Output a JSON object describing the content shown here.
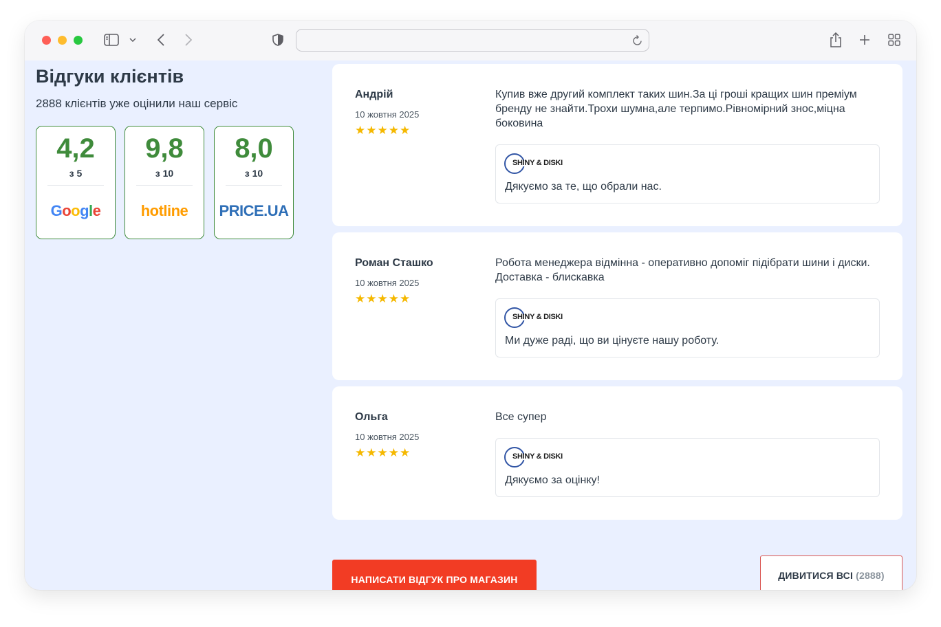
{
  "browser": {
    "address_value": ""
  },
  "sidebar": {
    "title": "Відгуки клієнтів",
    "subtitle": "2888 клієнтів уже оцінили наш сервіс",
    "ratings": [
      {
        "score": "4,2",
        "outof": "з 5",
        "brand": "Google"
      },
      {
        "score": "9,8",
        "outof": "з 10",
        "brand": "hotline"
      },
      {
        "score": "8,0",
        "outof": "з 10",
        "brand": "PRICE.UA"
      }
    ]
  },
  "reviews": [
    {
      "author": "Андрій",
      "date": "10 жовтня 2025",
      "stars": "★★★★★",
      "rating": 5,
      "text": "Купив вже другий комплект таких шин.За ці гроші кращих шин преміум бренду не знайти.Трохи шумна,але терпимо.Рівномірний знос,міцна боковина",
      "reply_brand": "SHINY & DISKI",
      "reply": "Дякуємо за те, що обрали нас."
    },
    {
      "author": "Роман Сташко",
      "date": "10 жовтня 2025",
      "stars": "★★★★★",
      "rating": 5,
      "text": "Робота менеджера відмінна - оперативно допоміг підібрати шини і диски. Доставка - блискавка",
      "reply_brand": "SHINY & DISKI",
      "reply": "Ми дуже раді, що ви цінуєте нашу роботу."
    },
    {
      "author": "Ольга",
      "date": "10 жовтня 2025",
      "stars": "★★★★★",
      "rating": 5,
      "text": "Все супер",
      "reply_brand": "SHINY & DISKI",
      "reply": "Дякуємо за оцінку!"
    }
  ],
  "actions": {
    "write_label": "НАПИСАТИ ВІДГУК ПРО МАГАЗИН",
    "view_all_label": "ДИВИТИСЯ ВСІ",
    "view_all_count": "(2888)"
  },
  "colors": {
    "accent_red": "#f23c24",
    "rating_green": "#3f8b3b",
    "star": "#f5b800",
    "page_bg": "#eaf0ff"
  }
}
